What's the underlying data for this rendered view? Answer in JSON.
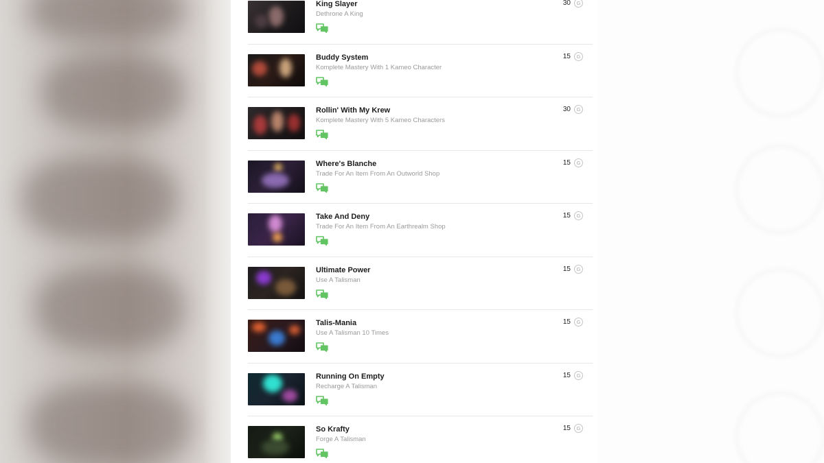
{
  "achievements": [
    {
      "title": "King Slayer",
      "description": "Dethrone A King",
      "points": "30",
      "badge": "G",
      "thumb": {
        "bg": "linear-gradient(135deg,#3a3335 0%,#1e1b1d 55%,#0f0e10 100%)",
        "glows": [
          [
            "#8a6a6a",
            "30px",
            "8px",
            "22px",
            "30px"
          ],
          [
            "#4d3d42",
            "10px",
            "20px",
            "20px",
            "20px"
          ]
        ]
      }
    },
    {
      "title": "Buddy System",
      "description": "Komplete Mastery With 1 Kameo Character",
      "points": "15",
      "badge": "G",
      "thumb": {
        "bg": "linear-gradient(135deg,#1a1a1a 0%,#2a1a15 50%,#0d0b0a 100%)",
        "glows": [
          [
            "#b04a3a",
            "6px",
            "10px",
            "22px",
            "22px"
          ],
          [
            "#c9a27a",
            "46px",
            "6px",
            "18px",
            "28px"
          ]
        ]
      }
    },
    {
      "title": "Rollin' With My Krew",
      "description": "Komplete Mastery With 5 Kameo Characters",
      "points": "30",
      "badge": "G",
      "thumb": {
        "bg": "linear-gradient(135deg,#2e2a2c 0%,#1f1a1c 50%,#120f10 100%)",
        "glows": [
          [
            "#a83a3a",
            "8px",
            "12px",
            "20px",
            "28px"
          ],
          [
            "#b7826a",
            "34px",
            "6px",
            "18px",
            "30px"
          ],
          [
            "#9a3030",
            "58px",
            "10px",
            "18px",
            "26px"
          ]
        ]
      }
    },
    {
      "title": "Where's Blanche",
      "description": "Trade For An Item From An Outworld Shop",
      "points": "15",
      "badge": "G",
      "thumb": {
        "bg": "linear-gradient(135deg,#1b1726 0%,#2d2038 50%,#120f18 100%)",
        "glows": [
          [
            "#e0b060",
            "38px",
            "4px",
            "12px",
            "12px"
          ],
          [
            "#8a6ab0",
            "20px",
            "18px",
            "40px",
            "22px"
          ]
        ]
      }
    },
    {
      "title": "Take And Deny",
      "description": "Trade For An Item From An Earthrealm Shop",
      "points": "15",
      "badge": "G",
      "thumb": {
        "bg": "linear-gradient(135deg,#2a1e3a 0%,#3a2448 50%,#1a1222 100%)",
        "glows": [
          [
            "#d08ad0",
            "30px",
            "2px",
            "20px",
            "26px"
          ],
          [
            "#f0a050",
            "36px",
            "28px",
            "14px",
            "14px"
          ]
        ]
      }
    },
    {
      "title": "Ultimate Power",
      "description": "Use A Talisman",
      "points": "15",
      "badge": "G",
      "thumb": {
        "bg": "linear-gradient(135deg,#201c20 0%,#2b2420 50%,#141212 100%)",
        "glows": [
          [
            "#8a3ad0",
            "12px",
            "6px",
            "22px",
            "20px"
          ],
          [
            "#7a5a3a",
            "40px",
            "18px",
            "30px",
            "24px"
          ]
        ]
      }
    },
    {
      "title": "Talis-Mania",
      "description": "Use A Talisman 10 Times",
      "points": "15",
      "badge": "G",
      "thumb": {
        "bg": "linear-gradient(135deg,#3a1a12 0%,#2a1a20 50%,#120c10 100%)",
        "glows": [
          [
            "#e06030",
            "6px",
            "4px",
            "20px",
            "14px"
          ],
          [
            "#3a7ad0",
            "30px",
            "16px",
            "24px",
            "22px"
          ],
          [
            "#d05a30",
            "60px",
            "8px",
            "16px",
            "14px"
          ]
        ]
      }
    },
    {
      "title": "Running On Empty",
      "description": "Recharge A Talisman",
      "points": "15",
      "badge": "G",
      "thumb": {
        "bg": "linear-gradient(135deg,#0e2a30 0%,#1a2430 50%,#0a1216 100%)",
        "glows": [
          [
            "#30e0d0",
            "22px",
            "2px",
            "28px",
            "26px"
          ],
          [
            "#a04aa0",
            "50px",
            "24px",
            "22px",
            "18px"
          ]
        ]
      }
    },
    {
      "title": "So Krafty",
      "description": "Forge A Talisman",
      "points": "15",
      "badge": "G",
      "thumb": {
        "bg": "linear-gradient(135deg,#151a14 0%,#1c2218 50%,#0b0e0a 100%)",
        "glows": [
          [
            "#9ad06a",
            "36px",
            "10px",
            "14px",
            "14px"
          ],
          [
            "#3a4a30",
            "20px",
            "20px",
            "40px",
            "22px"
          ]
        ]
      }
    }
  ],
  "colors": {
    "comment_icon": "#62c462",
    "title": "#1c1c1c",
    "description": "#9a9a9a",
    "divider": "#e6e6e6"
  }
}
